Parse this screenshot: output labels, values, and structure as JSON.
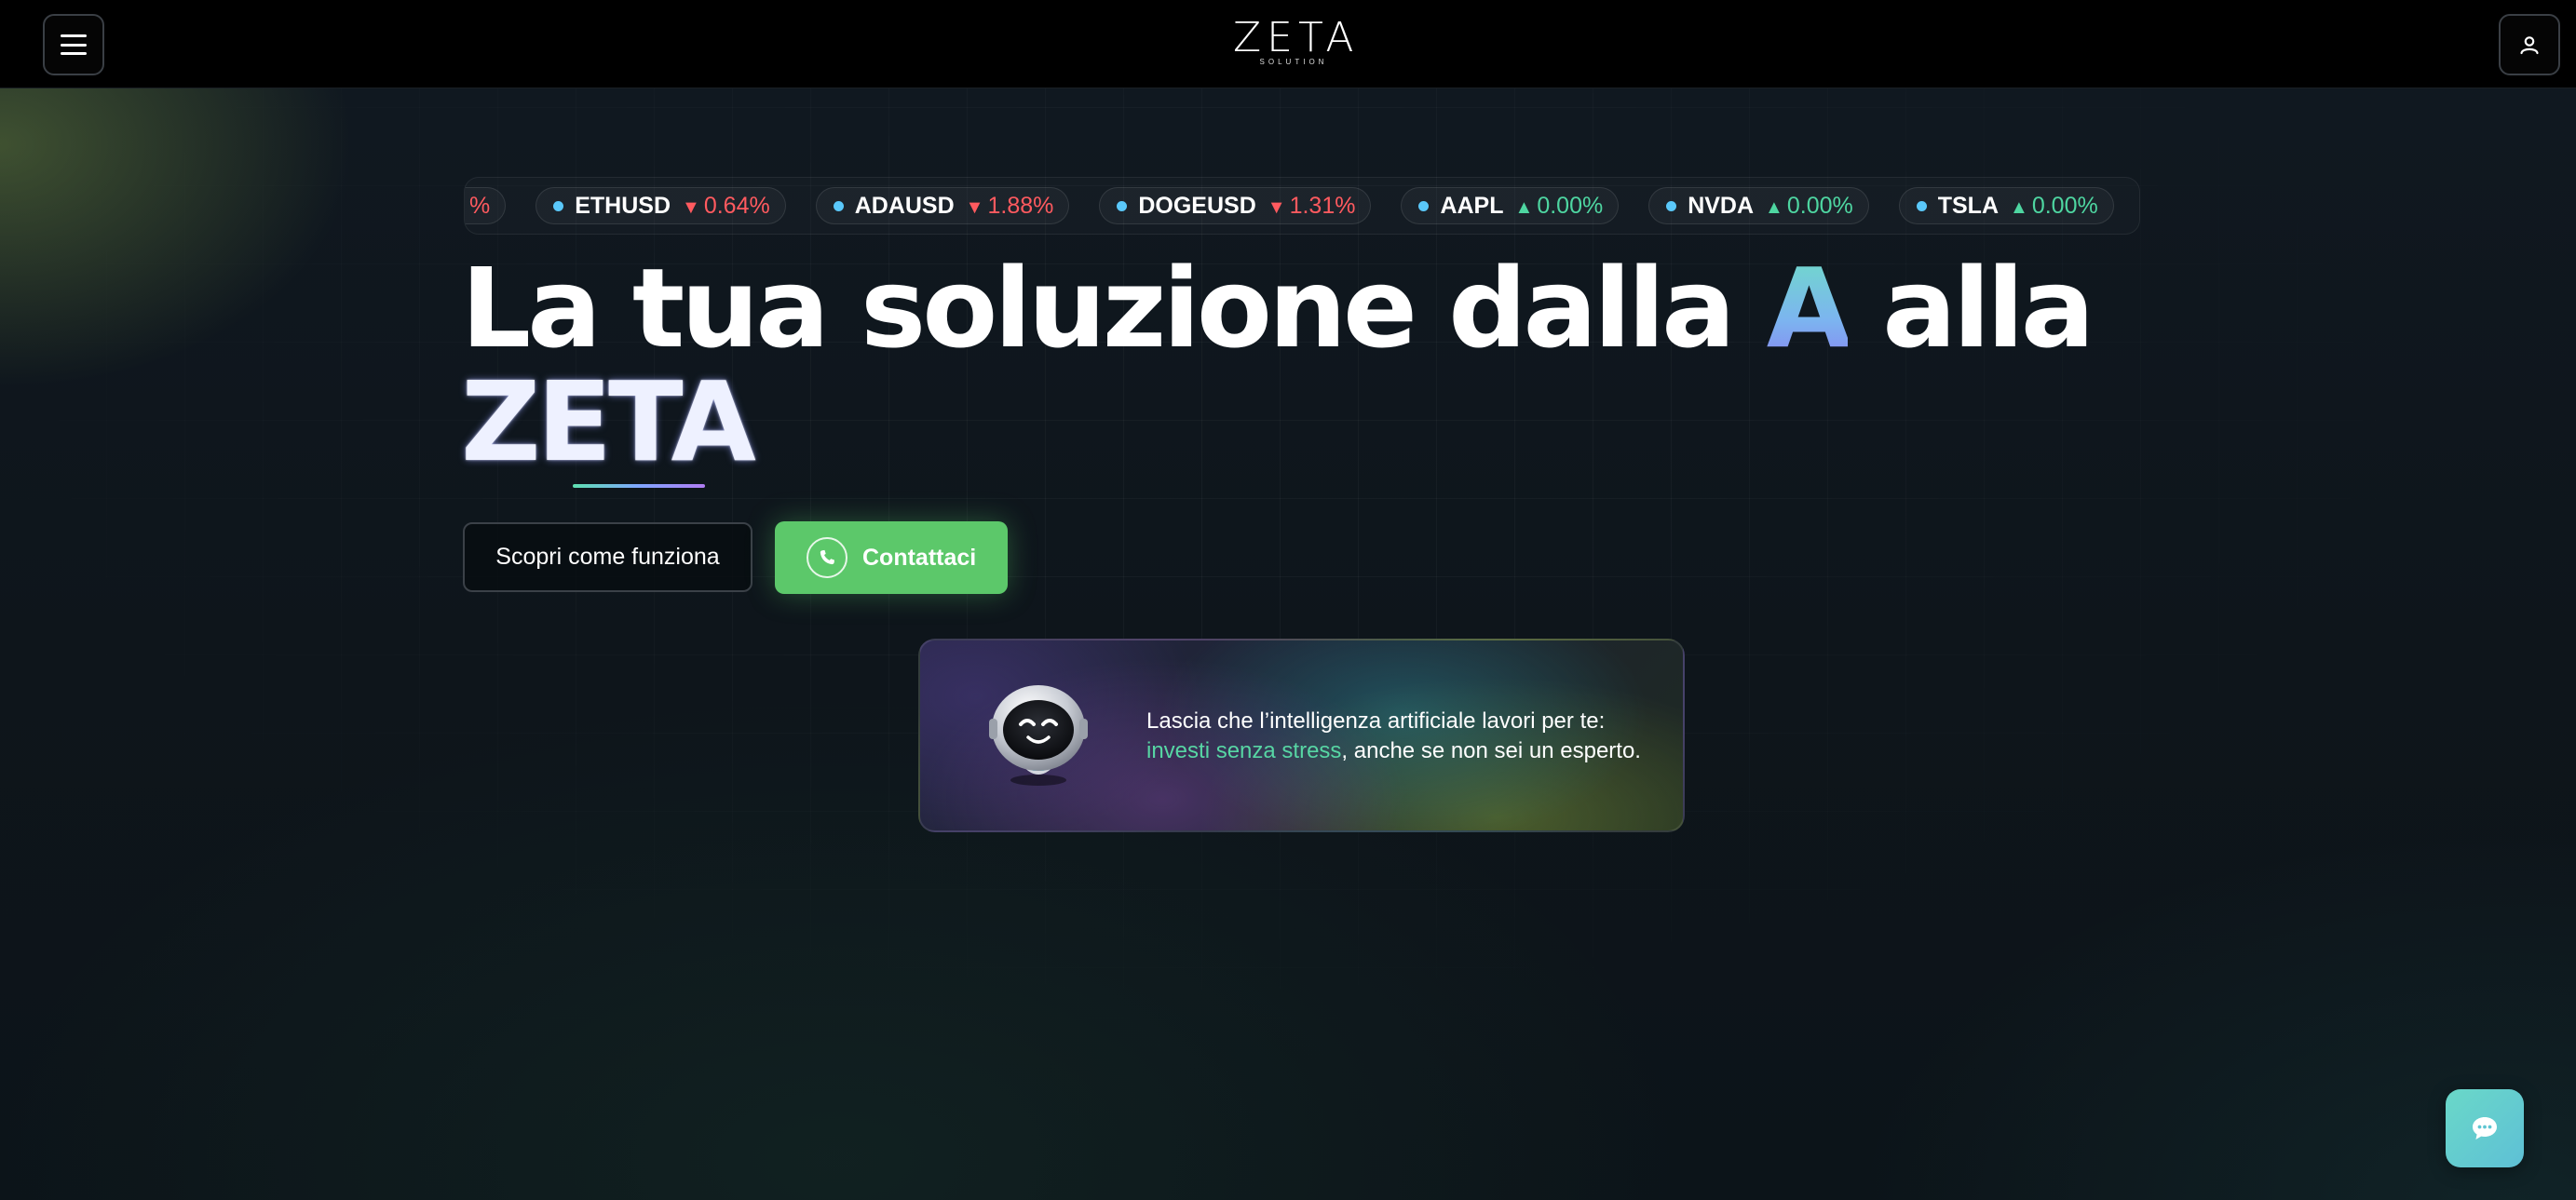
{
  "header": {
    "logo_text": "ZETA",
    "logo_subtext": "SOLUTION",
    "menu_icon": "hamburger-icon",
    "user_icon": "user-icon"
  },
  "ticker": {
    "partial_left": "%",
    "items": [
      {
        "symbol": "ETHUSD",
        "direction": "down",
        "arrow": "▼",
        "change": "0.64%"
      },
      {
        "symbol": "ADAUSD",
        "direction": "down",
        "arrow": "▼",
        "change": "1.88%"
      },
      {
        "symbol": "DOGEUSD",
        "direction": "down",
        "arrow": "▼",
        "change": "1.31%"
      },
      {
        "symbol": "AAPL",
        "direction": "up",
        "arrow": "▲",
        "change": "0.00%"
      },
      {
        "symbol": "NVDA",
        "direction": "up",
        "arrow": "▲",
        "change": "0.00%"
      },
      {
        "symbol": "TSLA",
        "direction": "up",
        "arrow": "▲",
        "change": "0.00%"
      }
    ],
    "colors": {
      "down": "#ff5a5f",
      "up": "#4ed6a1",
      "dot": "#5ac8fa"
    }
  },
  "hero": {
    "headline_part1": "La tua soluzione dalla ",
    "headline_highlight": "A",
    "headline_part2": " alla",
    "headline_line2": "ZETA"
  },
  "actions": {
    "secondary_label": "Scopri come funziona",
    "primary_label": "Contattaci",
    "primary_icon": "phone-icon",
    "primary_color": "#5cc86a"
  },
  "ai_card": {
    "text_before": "Lascia che l’intelligenza artificiale lavori per te: ",
    "highlight": "investi senza stress",
    "text_after": ", anche se non sei un esperto.",
    "icon": "robot-icon"
  },
  "chat": {
    "icon": "chat-bubble-icon"
  }
}
